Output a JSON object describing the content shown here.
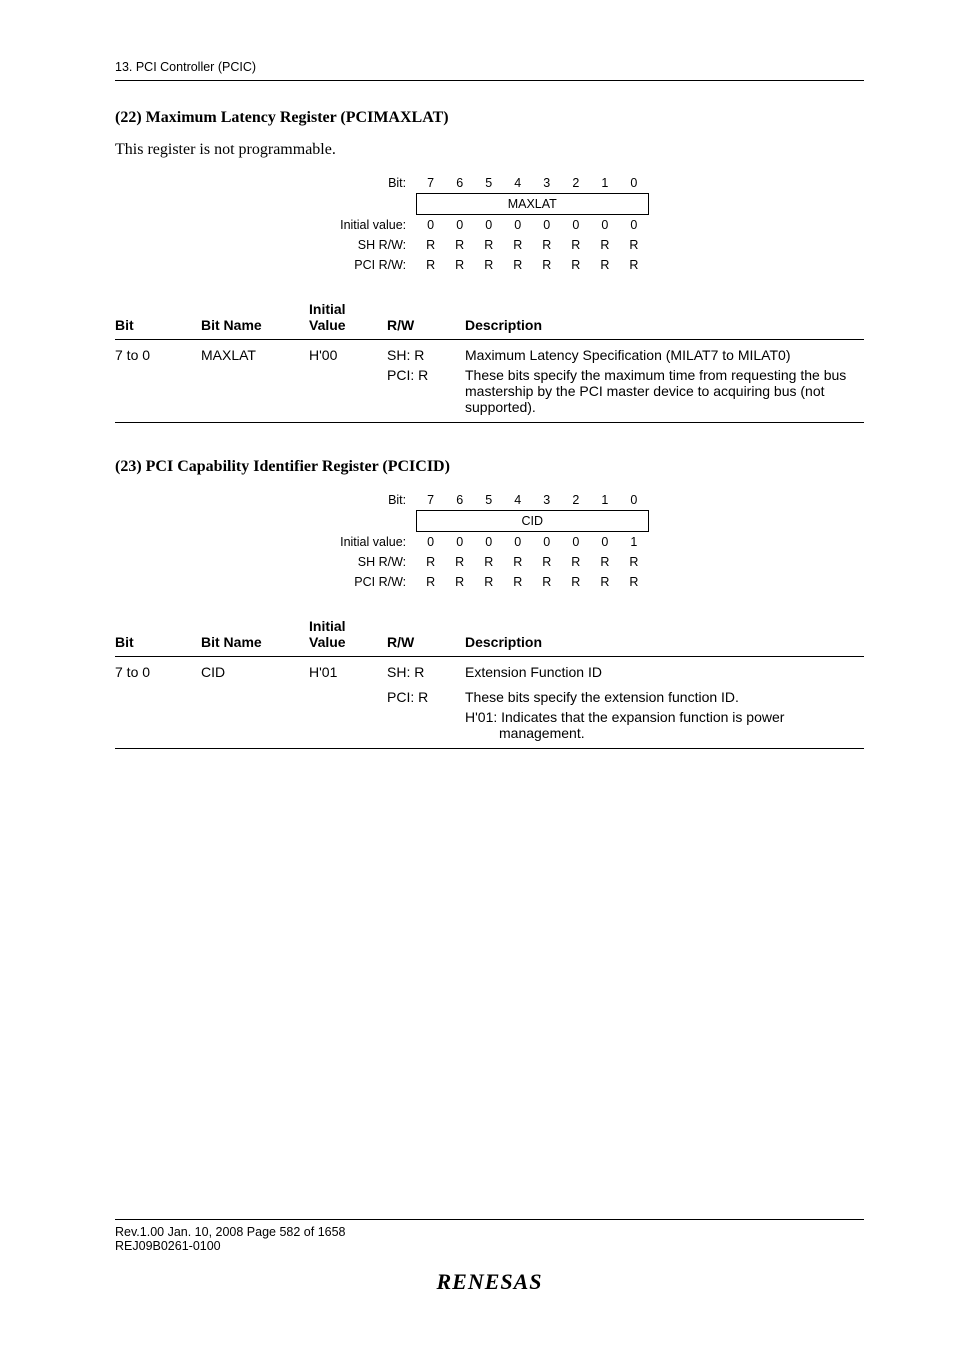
{
  "header": {
    "section_ref": "13.   PCI Controller (PCIC)"
  },
  "section22": {
    "title": "(22)  Maximum Latency Register (PCIMAXLAT)",
    "intro": "This register is not programmable.",
    "bits": {
      "label_bit": "Bit:",
      "cols": [
        "7",
        "6",
        "5",
        "4",
        "3",
        "2",
        "1",
        "0"
      ],
      "reg_name": "MAXLAT",
      "label_iv": "Initial value:",
      "iv": [
        "0",
        "0",
        "0",
        "0",
        "0",
        "0",
        "0",
        "0"
      ],
      "label_shrw": "SH R/W:",
      "shrw": [
        "R",
        "R",
        "R",
        "R",
        "R",
        "R",
        "R",
        "R"
      ],
      "label_pcirw": "PCI R/W:",
      "pcirw": [
        "R",
        "R",
        "R",
        "R",
        "R",
        "R",
        "R",
        "R"
      ]
    },
    "desc": {
      "headers": {
        "bit": "Bit",
        "name": "Bit Name",
        "iv": "Initial\nValue",
        "rw": "R/W",
        "desc": "Description"
      },
      "rows": [
        {
          "bit": "7 to 0",
          "name": "MAXLAT",
          "iv": "H'00",
          "rw1": "SH: R",
          "rw2": "PCI: R",
          "d1": "Maximum Latency Specification (MILAT7 to MILAT0)",
          "d2": "These bits specify the maximum time from requesting the bus mastership by the PCI master device to acquiring bus (not supported)."
        }
      ]
    }
  },
  "section23": {
    "title": "(23)  PCI Capability Identifier Register (PCICID)",
    "bits": {
      "label_bit": "Bit:",
      "cols": [
        "7",
        "6",
        "5",
        "4",
        "3",
        "2",
        "1",
        "0"
      ],
      "reg_name": "CID",
      "label_iv": "Initial value:",
      "iv": [
        "0",
        "0",
        "0",
        "0",
        "0",
        "0",
        "0",
        "1"
      ],
      "label_shrw": "SH R/W:",
      "shrw": [
        "R",
        "R",
        "R",
        "R",
        "R",
        "R",
        "R",
        "R"
      ],
      "label_pcirw": "PCI R/W:",
      "pcirw": [
        "R",
        "R",
        "R",
        "R",
        "R",
        "R",
        "R",
        "R"
      ]
    },
    "desc": {
      "headers": {
        "bit": "Bit",
        "name": "Bit Name",
        "iv": "Initial\nValue",
        "rw": "R/W",
        "desc": "Description"
      },
      "rows": [
        {
          "bit": "7 to 0",
          "name": "CID",
          "iv": "H'01",
          "rw1": "SH: R",
          "rw2": "PCI: R",
          "d1": "Extension Function ID",
          "d2": "These bits specify the extension function ID.",
          "d3": "H'01: Indicates that the expansion function is power management."
        }
      ]
    }
  },
  "footer": {
    "line1": "Rev.1.00  Jan. 10, 2008  Page 582 of 1658",
    "line2": "REJ09B0261-0100",
    "logo": "RENESAS"
  }
}
